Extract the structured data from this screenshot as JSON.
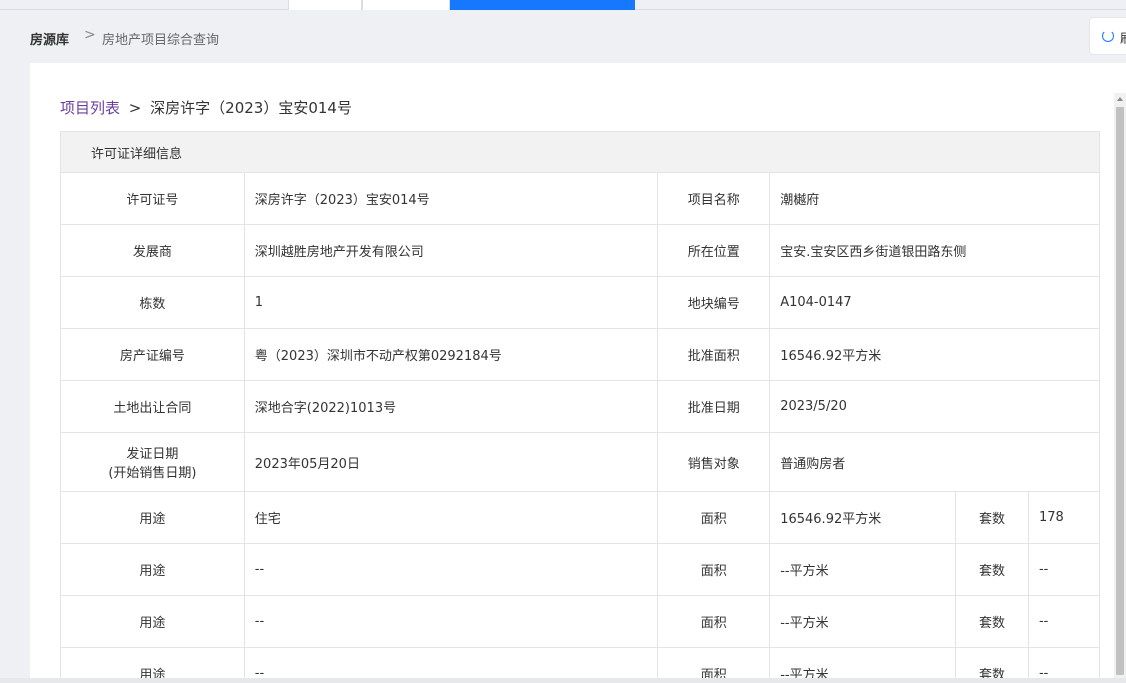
{
  "header": {
    "crumb_root": "房源库",
    "crumb_sep": ">",
    "crumb_current": "房地产项目综合查询",
    "refresh_label": "刷"
  },
  "sub": {
    "link": "项目列表",
    "gt": ">",
    "title": "深房许字（2023）宝安014号"
  },
  "section_title": "许可证详细信息",
  "rows": [
    {
      "l1": "许可证号",
      "v1": "深房许字（2023）宝安014号",
      "l2": "项目名称",
      "v2": "潮樾府"
    },
    {
      "l1": "发展商",
      "v1": "深圳越胜房地产开发有限公司",
      "l2": "所在位置",
      "v2": "宝安.宝安区西乡街道银田路东侧"
    },
    {
      "l1": "栋数",
      "v1": "1",
      "l2": "地块编号",
      "v2": "A104-0147"
    },
    {
      "l1": "房产证编号",
      "v1": "粤（2023）深圳市不动产权第0292184号",
      "l2": "批准面积",
      "v2": "16546.92平方米"
    },
    {
      "l1": "土地出让合同",
      "v1": "深地合字(2022)1013号",
      "l2": "批准日期",
      "v2": "2023/5/20"
    },
    {
      "l1": "发证日期",
      "l1b": "(开始销售日期)",
      "v1": "2023年05月20日",
      "l2": "销售对象",
      "v2": "普通购房者"
    }
  ],
  "usage_rows": [
    {
      "l1": "用途",
      "v1": "住宅",
      "l2": "面积",
      "v2": "16546.92平方米",
      "l3": "套数",
      "v3": "178"
    },
    {
      "l1": "用途",
      "v1": "--",
      "l2": "面积",
      "v2": "--平方米",
      "l3": "套数",
      "v3": "--"
    },
    {
      "l1": "用途",
      "v1": "--",
      "l2": "面积",
      "v2": "--平方米",
      "l3": "套数",
      "v3": "--"
    },
    {
      "l1": "用途",
      "v1": "--",
      "l2": "面积",
      "v2": "--平方米",
      "l3": "套数",
      "v3": "--"
    }
  ],
  "colors": {
    "accent": "#1677ff",
    "link": "#6b3fa0"
  }
}
